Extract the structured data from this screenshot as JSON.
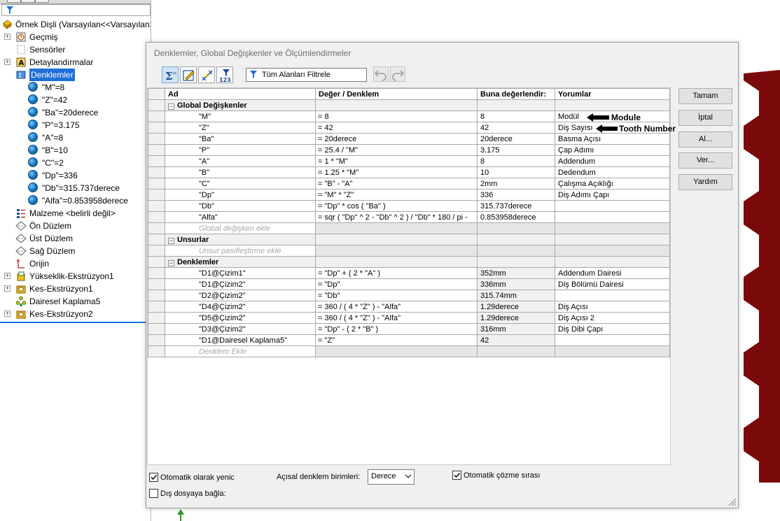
{
  "tree": {
    "root": "Örnek Dişli  (Varsayılan<<Varsayılan>",
    "items": [
      {
        "label": "Geçmiş",
        "icon": "history-icon",
        "expand": true
      },
      {
        "label": "Sensörler",
        "icon": "sensor-icon",
        "expand": false
      },
      {
        "label": "Detaylandırmalar",
        "icon": "annotation-icon",
        "expand": true
      },
      {
        "label": "Denklemler",
        "icon": "equations-icon",
        "expand": false,
        "selected": true
      },
      {
        "label": "\"M\"=8",
        "icon": "globe-icon",
        "child": true
      },
      {
        "label": "\"Z\"=42",
        "icon": "globe-icon",
        "child": true
      },
      {
        "label": "\"Ba\"=20derece",
        "icon": "globe-icon",
        "child": true
      },
      {
        "label": "\"P\"=3.175",
        "icon": "globe-icon",
        "child": true
      },
      {
        "label": "\"A\"=8",
        "icon": "globe-icon",
        "child": true
      },
      {
        "label": "\"B\"=10",
        "icon": "globe-icon",
        "child": true
      },
      {
        "label": "\"C\"=2",
        "icon": "globe-icon",
        "child": true
      },
      {
        "label": "\"Dp\"=336",
        "icon": "globe-icon",
        "child": true
      },
      {
        "label": "\"Db\"=315.737derece",
        "icon": "globe-icon",
        "child": true
      },
      {
        "label": "\"Alfa\"=0.853958derece",
        "icon": "globe-icon",
        "child": true
      },
      {
        "label": "Malzeme <belirli değil>",
        "icon": "material-icon",
        "expand": false
      },
      {
        "label": "Ön Düzlem",
        "icon": "plane-icon",
        "expand": false
      },
      {
        "label": "Üst Düzlem",
        "icon": "plane-icon",
        "expand": false
      },
      {
        "label": "Sağ Düzlem",
        "icon": "plane-icon",
        "expand": false
      },
      {
        "label": "Orijin",
        "icon": "origin-icon",
        "expand": false
      },
      {
        "label": "Yükseklik-Ekstrüzyon1",
        "icon": "extrude-icon",
        "expand": true
      },
      {
        "label": "Kes-Ekstrüzyon1",
        "icon": "cut-extrude-icon",
        "expand": true
      },
      {
        "label": "Dairesel Kaplama5",
        "icon": "circular-pattern-icon",
        "expand": false
      },
      {
        "label": "Kes-Ekstrüzyon2",
        "icon": "cut-extrude-icon",
        "expand": true
      }
    ]
  },
  "dialog": {
    "title": "Denklemler, Global Değişkenler ve Ölçümlendirmeler",
    "filter_text": "Tüm Alanları Filtrele",
    "columns": [
      "Ad",
      "Değer / Denklem",
      "Buna değerlendir:",
      "Yorumlar"
    ],
    "sections": [
      {
        "title": "Global Değişkenler",
        "rows": [
          {
            "name": "\"M\"",
            "eq": "= 8",
            "val": "8",
            "comment": "Modül"
          },
          {
            "name": "\"Z\"",
            "eq": "= 42",
            "val": "42",
            "comment": "Diş Sayısı"
          },
          {
            "name": "\"Ba\"",
            "eq": "= 20derece",
            "val": "20derece",
            "comment": "Basma Açısı"
          },
          {
            "name": "\"P\"",
            "eq": "= 25.4 / \"M\"",
            "val": "3.175",
            "comment": "Çap Adımı"
          },
          {
            "name": "\"A\"",
            "eq": "= 1 * \"M\"",
            "val": "8",
            "comment": "Addendum"
          },
          {
            "name": "\"B\"",
            "eq": "= 1.25 * \"M\"",
            "val": "10",
            "comment": "Dedendum"
          },
          {
            "name": "\"C\"",
            "eq": "= \"B\" - \"A\"",
            "val": "2mm",
            "comment": "Çalışma Açıklığı"
          },
          {
            "name": "\"Dp\"",
            "eq": "= \"M\" * \"Z\"",
            "val": "336",
            "comment": "Diş Adımı Çapı"
          },
          {
            "name": "\"Db\"",
            "eq": "= \"Dp\" * cos ( \"Ba\" )",
            "val": "315.737derece",
            "comment": ""
          },
          {
            "name": "\"Alfa\"",
            "eq": "= sqr ( \"Dp\" ^ 2 - \"Db\" ^ 2 ) / \"Db\" * 180 / pi -",
            "val": "0.853958derece",
            "comment": ""
          }
        ],
        "add_label": "Global değişken ekle"
      },
      {
        "title": "Unsurlar",
        "rows": [],
        "add_label": "Unsur pasifleştirme ekle"
      },
      {
        "title": "Denklemler",
        "rows": [
          {
            "name": "\"D1@Çizim1\"",
            "eq": "= \"Dp\" + ( 2 * \"A\" )",
            "val": "352mm",
            "comment": "Addendum Dairesi"
          },
          {
            "name": "\"D1@Çizim2\"",
            "eq": "= \"Dp\"",
            "val": "336mm",
            "comment": "Diş Bölümü Dairesi"
          },
          {
            "name": "\"D2@Çizim2\"",
            "eq": "= \"Db\"",
            "val": "315.74mm",
            "comment": ""
          },
          {
            "name": "\"D4@Çizim2\"",
            "eq": "= 360 / ( 4 * \"Z\" ) - \"Alfa\"",
            "val": "1.29derece",
            "comment": "Diş Açısı"
          },
          {
            "name": "\"D5@Çizim2\"",
            "eq": "= 360 / ( 4 * \"Z\" ) - \"Alfa\"",
            "val": "1.29derece",
            "comment": "Diş Açısı 2"
          },
          {
            "name": "\"D3@Çizim2\"",
            "eq": "= \"Dp\" - ( 2 * \"B\" )",
            "val": "316mm",
            "comment": "Diş Dibi Çapı"
          },
          {
            "name": "\"D1@Dairesel Kaplama5\"",
            "eq": "= \"Z\"",
            "val": "42",
            "comment": ""
          }
        ],
        "add_label": "Denklem Ekle"
      }
    ],
    "buttons": {
      "ok": "Tamam",
      "cancel": "İptal",
      "import": "Al...",
      "export": "Ver...",
      "help": "Yardım"
    },
    "options": {
      "auto_rebuild": {
        "label": "Otomatik olarak yenic",
        "checked": true
      },
      "link_external": {
        "label": "Dış dosyaya bağla:",
        "checked": false
      },
      "angular_units_label": "Açısal denklem birimleri:",
      "angular_units_value": "Derece",
      "auto_solve": {
        "label": "Otomatik çözme sırası",
        "checked": true
      }
    }
  },
  "annotations": {
    "module": "Module",
    "tooth_number": "Tooth Number"
  },
  "colors": {
    "selection": "#1e6fd9",
    "gear": "#7a0a0a",
    "dialog_bg": "#f0f0f0"
  }
}
